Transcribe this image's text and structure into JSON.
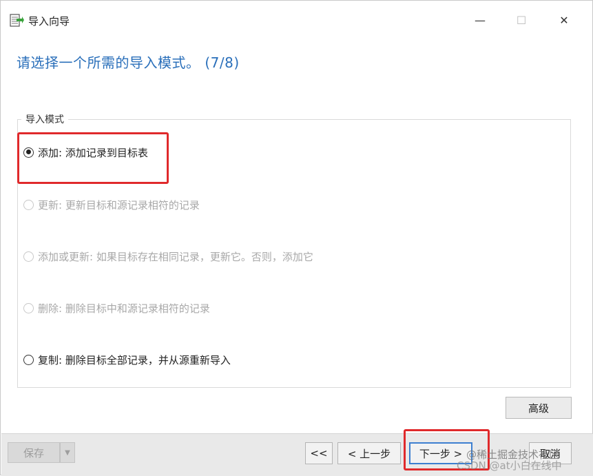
{
  "window": {
    "title": "导入向导",
    "minimize": "—",
    "maximize": "☐",
    "close": "✕"
  },
  "heading": "请选择一个所需的导入模式。 (7/8)",
  "group": {
    "legend": "导入模式",
    "options": [
      {
        "label": "添加: 添加记录到目标表",
        "checked": true,
        "enabled": true
      },
      {
        "label": "更新: 更新目标和源记录相符的记录",
        "checked": false,
        "enabled": false
      },
      {
        "label": "添加或更新: 如果目标存在相同记录，更新它。否则，添加它",
        "checked": false,
        "enabled": false
      },
      {
        "label": "删除: 删除目标中和源记录相符的记录",
        "checked": false,
        "enabled": false
      },
      {
        "label": "复制: 删除目标全部记录，并从源重新导入",
        "checked": false,
        "enabled": true
      }
    ]
  },
  "buttons": {
    "advanced": "高级",
    "save": "保存",
    "save_dropdown": "▼",
    "first": "<<",
    "prev": "< 上一步",
    "next": "下一步 >",
    "last": "取消"
  },
  "watermark": {
    "line1": "@稀土掘金技术社区",
    "line2": "CSDN @at小白在线中"
  },
  "colors": {
    "heading": "#2a6fba",
    "highlight": "#e0292b"
  }
}
